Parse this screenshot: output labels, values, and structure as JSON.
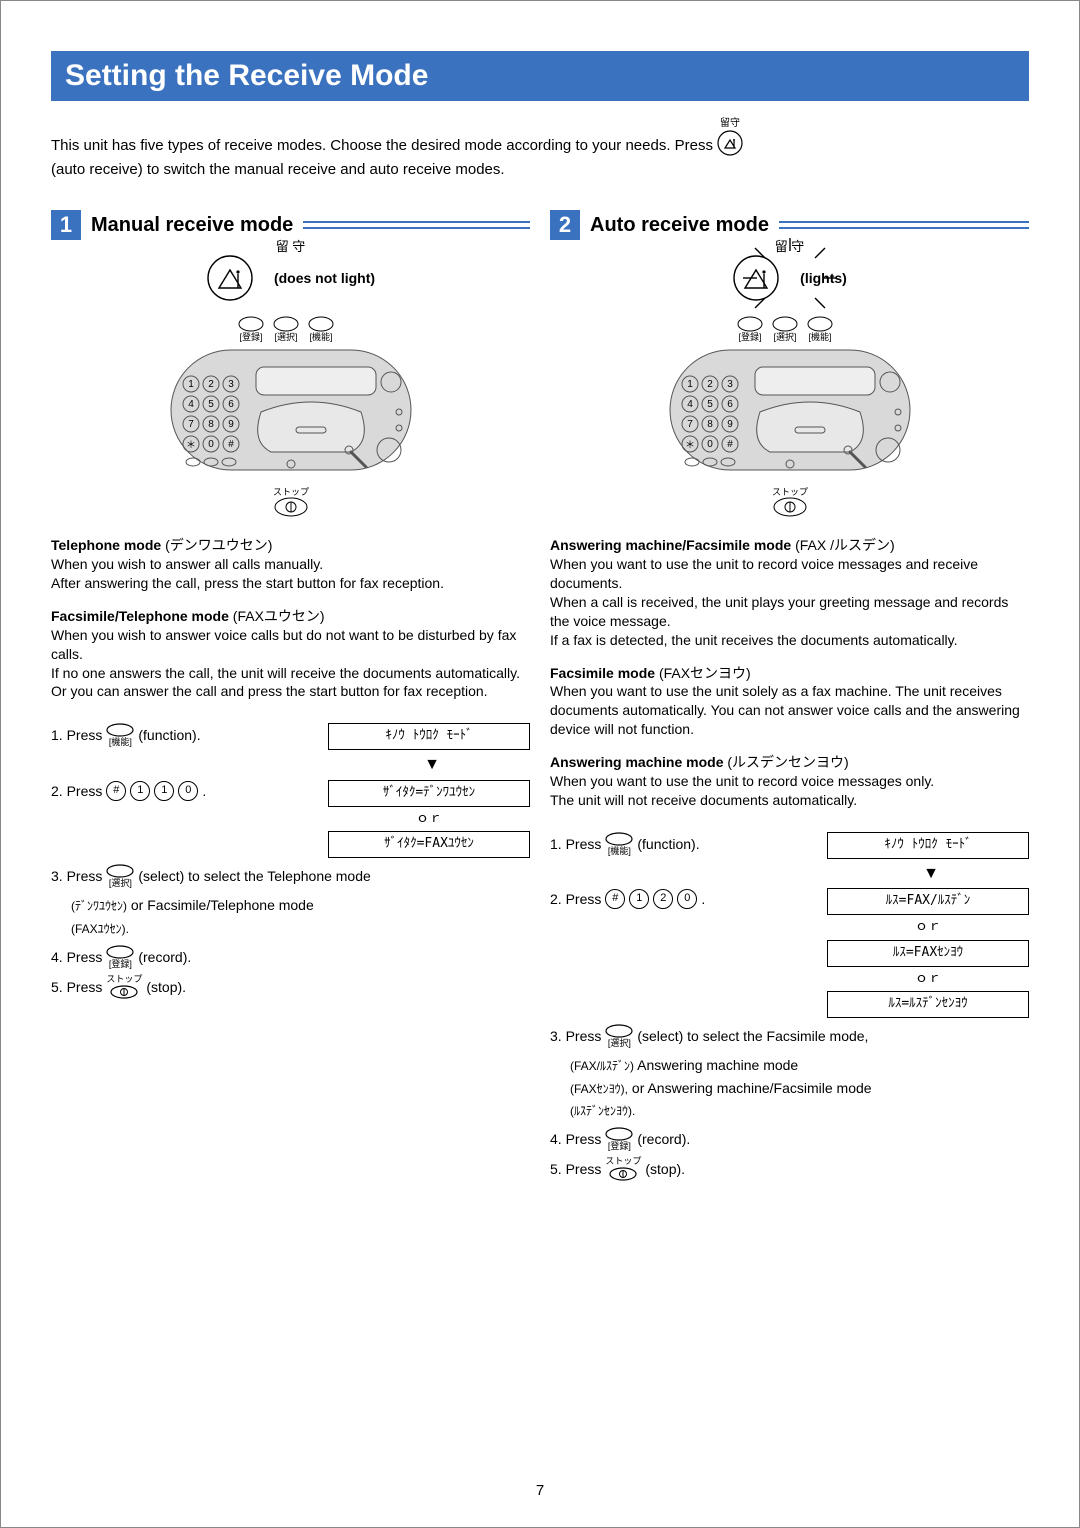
{
  "page_title": "Setting the Receive Mode",
  "intro_part1": "This unit has five types of receive modes. Choose the desired mode according to your needs. Press",
  "intro_rusu_label": "留守",
  "intro_part2": "(auto receive) to switch the manual receive and auto receive modes.",
  "sections": {
    "manual": {
      "num": "1",
      "title": "Manual receive mode",
      "rusu_label": "留 守",
      "status_label": "(does not light)",
      "modes": {
        "tel": {
          "heading": "Telephone mode",
          "heading_jp": "(デンワユウセン)",
          "body": "When you wish to answer all calls manually.\nAfter answering the call, press the start button for fax reception."
        },
        "faxtel": {
          "heading": "Facsimile/Telephone mode",
          "heading_jp": "(FAXユウセン)",
          "body": "When you wish to answer voice calls but do not want to be disturbed by fax calls.\nIf no one answers the call, the unit will receive the documents automatically. Or you can answer the call and press the start button for fax reception."
        }
      },
      "steps": {
        "s1_pre": "1. Press",
        "s1_btn_bot": "[機能]",
        "s1_post": "(function).",
        "s1_lcd": "ｷﾉｳ ﾄｳﾛｸ ﾓｰﾄﾞ",
        "s2_pre": "2. Press",
        "s2_keys": [
          "#",
          "1",
          "1",
          "0"
        ],
        "s2_lcd1": "ｻﾞｲﾀｸ=ﾃﾞﾝﾜﾕｳｾﾝ",
        "s2_or": "ｏｒ",
        "s2_lcd2": "ｻﾞｲﾀｸ=FAXﾕｳｾﾝ",
        "s3_pre": "3. Press",
        "s3_btn_bot": "[選択]",
        "s3_post1": "(select) to select the Telephone mode",
        "s3_jp1": "(ﾃﾞﾝﾜﾕｳｾﾝ)",
        "s3_post2": "or Facsimile/Telephone mode",
        "s3_jp2": "(FAXﾕｳｾﾝ).",
        "s4_pre": "4. Press",
        "s4_btn_bot": "[登録]",
        "s4_post": "(record).",
        "s5_pre": "5. Press",
        "s5_btn_top": "ストップ",
        "s5_post": "(stop)."
      }
    },
    "auto": {
      "num": "2",
      "title": "Auto receive mode",
      "rusu_label": "留 守",
      "status_label": "(lights)",
      "modes": {
        "ansfax": {
          "heading": "Answering machine/Facsimile mode",
          "heading_jp": "(FAX /ルスデン)",
          "body": "When you want to use the unit to record voice messages and receive documents.\nWhen a call is received, the unit plays your greeting message and records the voice message.\nIf a fax is detected, the unit receives the documents automatically."
        },
        "fax": {
          "heading": "Facsimile mode",
          "heading_jp": "(FAXセンヨウ)",
          "body": "When you want to use the unit solely as a fax machine. The unit receives documents automatically. You can not answer voice calls and the answering device will not function."
        },
        "ans": {
          "heading": "Answering machine mode",
          "heading_jp": "(ルスデンセンヨウ)",
          "body": "When you want to use the unit to record voice messages only.\nThe unit will not receive documents automatically."
        }
      },
      "steps": {
        "s1_pre": "1. Press",
        "s1_btn_bot": "[機能]",
        "s1_post": "(function).",
        "s1_lcd": "ｷﾉｳ ﾄｳﾛｸ ﾓｰﾄﾞ",
        "s2_pre": "2. Press",
        "s2_keys": [
          "#",
          "1",
          "2",
          "0"
        ],
        "s2_lcd1": "ﾙｽ=FAX/ﾙｽﾃﾞﾝ",
        "s2_or": "ｏｒ",
        "s2_lcd2": "ﾙｽ=FAXｾﾝﾖｳ",
        "s2_lcd3": "ﾙｽ=ﾙｽﾃﾞﾝｾﾝﾖｳ",
        "s3_pre": "3. Press",
        "s3_btn_bot": "[選択]",
        "s3_post1": "(select) to select the Facsimile mode,",
        "s3_jp1": "(FAX/ﾙｽﾃﾞﾝ)",
        "s3_post2": "Answering machine mode",
        "s3_jp2": "(FAXｾﾝﾖｳ),",
        "s3_post3": "or Answering machine/Facsimile mode",
        "s3_jp3": "(ﾙｽﾃﾞﾝｾﾝﾖｳ).",
        "s4_pre": "4. Press",
        "s4_btn_bot": "[登録]",
        "s4_post": "(record).",
        "s5_pre": "5. Press",
        "s5_btn_top": "ストップ",
        "s5_post": "(stop)."
      }
    }
  },
  "device_panel_labels": [
    "[登録]",
    "[選択]",
    "[機能]"
  ],
  "device_stop_label": "ストップ",
  "page_number": "7"
}
